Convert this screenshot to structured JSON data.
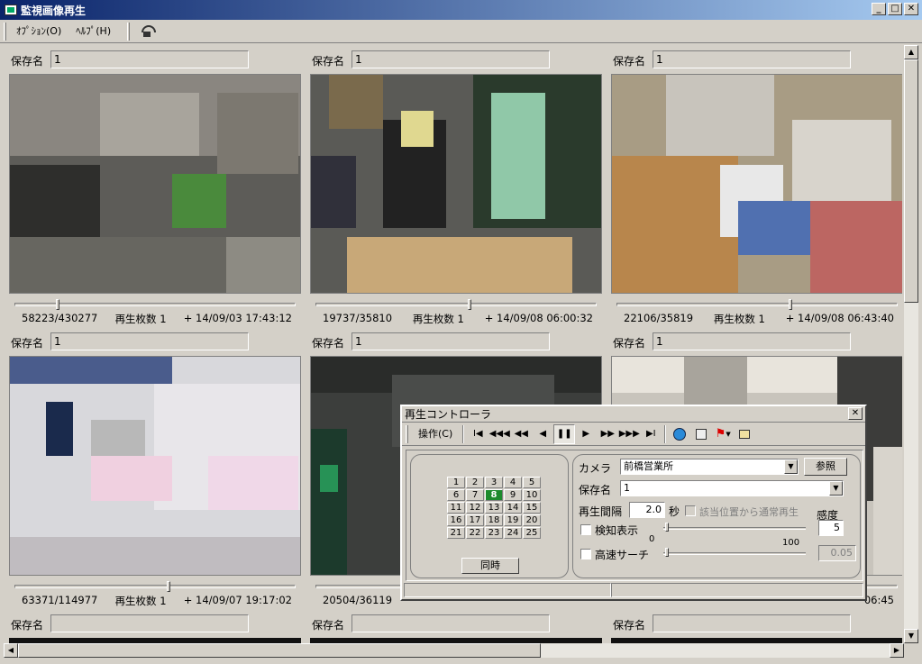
{
  "window": {
    "title": "監視画像再生",
    "app_icon": "monitor-icon"
  },
  "menu": {
    "items": [
      "ｵﾌﾟｼｮﾝ(O)",
      "ﾍﾙﾌﾟ(H)"
    ],
    "tool_icon": "phone-icon"
  },
  "save_label": "保存名",
  "cells": [
    {
      "save_name": "1",
      "frame": "58223/430277",
      "count_label": "再生枚数 1",
      "timestamp": "+ 14/09/03 17:43:12",
      "progress": 0.15,
      "scene": "store-interior",
      "tint": "#6b6a66"
    },
    {
      "save_name": "1",
      "frame": "19737/35810",
      "count_label": "再生枚数 1",
      "timestamp": "+ 14/09/08 06:00:32",
      "progress": 0.55,
      "scene": "store-entrance",
      "tint": "#6c6b64"
    },
    {
      "save_name": "1",
      "frame": "22106/35819",
      "count_label": "再生枚数 1",
      "timestamp": "+ 14/09/08 06:43:40",
      "progress": 0.62,
      "scene": "office-storage",
      "tint": "#9a8a6c"
    },
    {
      "save_name": "1",
      "frame": "63371/114977",
      "count_label": "再生枚数 1",
      "timestamp": "+ 14/09/07 19:17:02",
      "progress": 0.55,
      "scene": "office-desks",
      "tint": "#d8d6d8"
    },
    {
      "save_name": "1",
      "frame": "20504/36119",
      "count_label": "",
      "timestamp": "",
      "progress": 0.55,
      "scene": "dark-store",
      "tint": "#3a3c3a"
    },
    {
      "save_name": "1",
      "frame": "",
      "count_label": "",
      "timestamp": "06:45",
      "progress": 0.6,
      "scene": "shutter-room",
      "tint": "#c8c4bc"
    }
  ],
  "bottom_row_labels": [
    "保存名",
    "保存名",
    "保存名"
  ],
  "controller": {
    "title": "再生コントローラ",
    "op_menu": "操作(C)",
    "toolbar_icons": [
      "skip-start-icon",
      "fast-rewind-icon",
      "rewind-icon",
      "step-back-icon",
      "pause-icon",
      "play-icon",
      "fast-forward-icon",
      "skip-forward-icon",
      "skip-end-icon",
      "globe-icon",
      "save-icon",
      "flag-icon",
      "export-icon"
    ],
    "numbers": [
      "1",
      "2",
      "3",
      "4",
      "5",
      "6",
      "7",
      "8",
      "9",
      "10",
      "11",
      "12",
      "13",
      "14",
      "15",
      "16",
      "17",
      "18",
      "19",
      "20",
      "21",
      "22",
      "23",
      "24",
      "25"
    ],
    "active_number": "8",
    "sync_button": "同時",
    "camera_label": "カメラ",
    "camera_value": "前橋営業所",
    "browse_button": "参照",
    "save_label": "保存名",
    "save_value": "1",
    "interval_label": "再生間隔",
    "interval_value": "2.0",
    "interval_unit": "秒",
    "normal_play_label": "該当位置から通常再生",
    "sensitivity_label": "感度",
    "detect_label": "検知表示",
    "detect_value": "5",
    "range_min": "0",
    "range_max": "100",
    "search_label": "高速サーチ",
    "search_value": "0.05"
  }
}
